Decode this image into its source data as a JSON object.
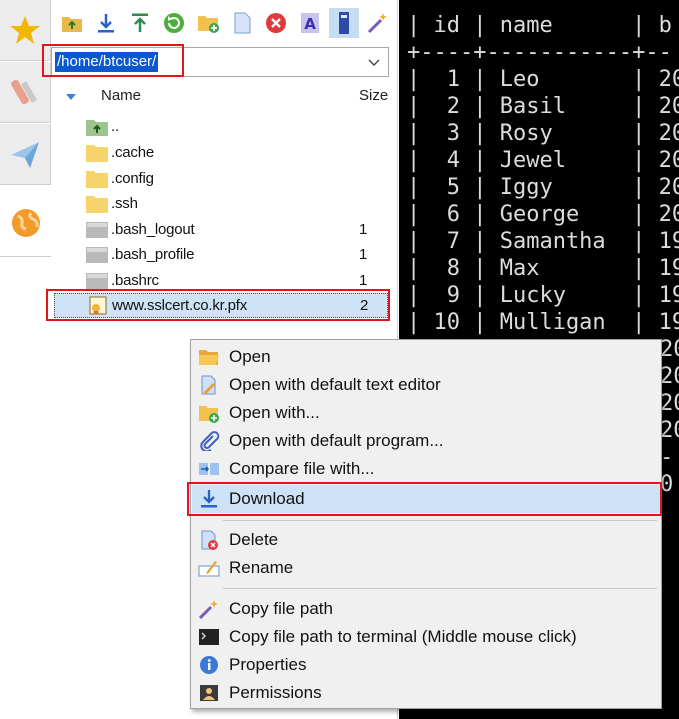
{
  "side_tabs": [
    {
      "icon": "star-icon",
      "active": false
    },
    {
      "icon": "tools-icon",
      "active": false
    },
    {
      "icon": "send-icon",
      "active": false
    },
    {
      "icon": "globe-icon",
      "active": true
    }
  ],
  "toolbar": {
    "buttons": [
      "parent-folder-icon",
      "download-icon",
      "upload-icon",
      "refresh-icon",
      "new-folder-icon",
      "new-file-icon",
      "delete-icon",
      "rename-icon",
      "terminal-icon",
      "magic-wand-icon"
    ]
  },
  "path": {
    "value": "/home/btcuser/"
  },
  "columns": {
    "name": "Name",
    "size": "Size"
  },
  "files": [
    {
      "name": "..",
      "size": "",
      "icon": "parent-folder-icon"
    },
    {
      "name": ".cache",
      "size": "",
      "icon": "folder-icon"
    },
    {
      "name": ".config",
      "size": "",
      "icon": "folder-icon"
    },
    {
      "name": ".ssh",
      "size": "",
      "icon": "folder-icon"
    },
    {
      "name": ".bash_logout",
      "size": "1",
      "icon": "file-icon"
    },
    {
      "name": ".bash_profile",
      "size": "1",
      "icon": "file-icon"
    },
    {
      "name": ".bashrc",
      "size": "1",
      "icon": "file-icon"
    },
    {
      "name": "www.sslcert.co.kr.pfx",
      "size": "2",
      "icon": "certificate-icon"
    }
  ],
  "terminal": {
    "lines": [
      "| id | name      | b",
      "+----+-----------+--",
      "|  1 | Leo       | 20",
      "|  2 | Basil     | 20",
      "|  3 | Rosy      | 20",
      "|  4 | Jewel     | 20",
      "|  5 | Iggy      | 20",
      "|  6 | George    | 20",
      "|  7 | Samantha  | 19",
      "|  8 | Max       | 19",
      "|  9 | Lucky     | 19",
      "| 10 | Mulligan  | 19"
    ],
    "partial_lines": [
      "20",
      "20",
      "20",
      "20",
      "-",
      "0"
    ]
  },
  "context_menu": {
    "items": [
      {
        "label": "Open",
        "icon": "folder-open-icon"
      },
      {
        "label": "Open with default text editor",
        "icon": "edit-file-icon"
      },
      {
        "label": "Open with...",
        "icon": "open-with-icon"
      },
      {
        "label": "Open with default program...",
        "icon": "paperclip-icon"
      },
      {
        "label": "Compare file with...",
        "icon": "compare-icon"
      },
      {
        "label": "Download",
        "icon": "download-icon"
      },
      {
        "label": "Delete",
        "icon": "delete-file-icon"
      },
      {
        "label": "Rename",
        "icon": "rename-icon"
      },
      {
        "label": "Copy file path",
        "icon": "magic-wand-icon"
      },
      {
        "label": "Copy file path to terminal (Middle mouse click)",
        "icon": "terminal-icon"
      },
      {
        "label": "Properties",
        "icon": "info-icon"
      },
      {
        "label": "Permissions",
        "icon": "permissions-icon"
      }
    ]
  },
  "colors": {
    "highlight_red": "#e5141c",
    "selection_blue": "#0a57d0",
    "menu_hover": "#cde2f6"
  }
}
